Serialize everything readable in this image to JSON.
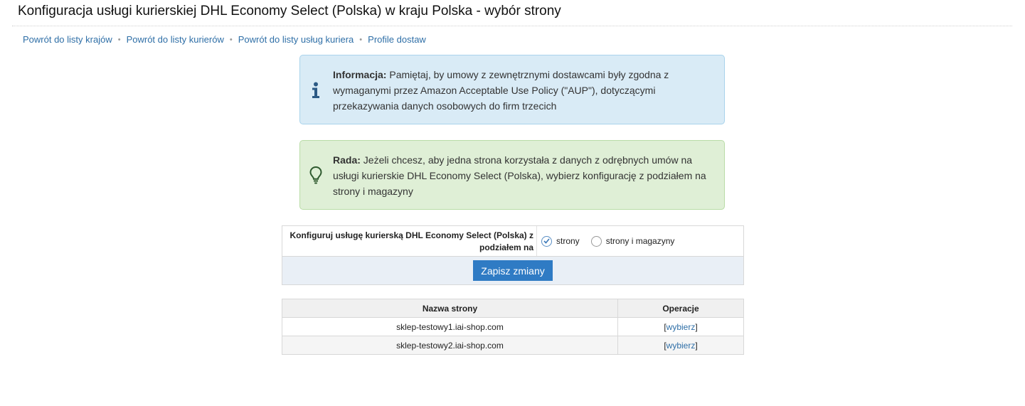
{
  "page": {
    "title": "Konfiguracja usługi kurierskiej DHL Economy Select (Polska) w kraju Polska - wybór strony"
  },
  "breadcrumb": {
    "links": [
      "Powrót do listy krajów",
      "Powrót do listy kurierów",
      "Powrót do listy usług kuriera",
      "Profile dostaw"
    ],
    "separator": "•"
  },
  "info_alert": {
    "icon": "info-icon",
    "label": "Informacja:",
    "text": " Pamiętaj, by umowy z zewnętrznymi dostawcami były zgodna z wymaganymi przez Amazon Acceptable Use Policy (\"AUP\"), dotyczącymi przekazywania danych osobowych do firm trzecich",
    "color": "#d9ebf6"
  },
  "tip_alert": {
    "icon": "lightbulb-icon",
    "label": "Rada:",
    "text": " Jeżeli chcesz, aby jedna strona korzystała z danych z odrębnych umów na usługi kurierskie DHL Economy Select (Polska), wybierz konfigurację z podziałem na strony i magazyny",
    "color": "#dfefd6"
  },
  "config": {
    "label": "Konfiguruj usługę kurierską DHL Economy Select (Polska) z podziałem na",
    "options": [
      {
        "label": "strony",
        "selected": true
      },
      {
        "label": "strony i magazyny",
        "selected": false
      }
    ],
    "save_label": "Zapisz zmiany",
    "accent": "#2f7bc4"
  },
  "table": {
    "headers": [
      "Nazwa strony",
      "Operacje"
    ],
    "rows": [
      {
        "name": "sklep-testowy1.iai-shop.com",
        "open": "[",
        "action": "wybierz",
        "close": "]"
      },
      {
        "name": "sklep-testowy2.iai-shop.com",
        "open": "[",
        "action": "wybierz",
        "close": "]"
      }
    ]
  }
}
